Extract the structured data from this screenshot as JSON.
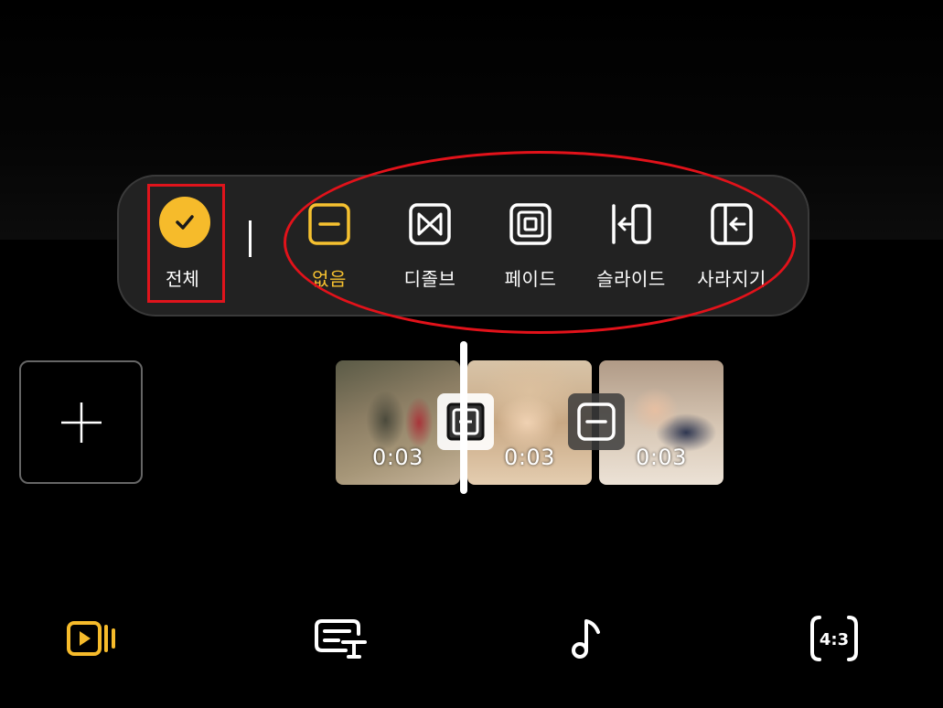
{
  "transition_panel": {
    "apply_all": {
      "label": "전체",
      "icon": "check-icon",
      "selected": true
    },
    "options": [
      {
        "key": "none",
        "label": "없음",
        "icon": "minus-square-icon",
        "active": true
      },
      {
        "key": "dissolve",
        "label": "디졸브",
        "icon": "dissolve-icon",
        "active": false
      },
      {
        "key": "fade",
        "label": "페이드",
        "icon": "fade-icon",
        "active": false
      },
      {
        "key": "slide",
        "label": "슬라이드",
        "icon": "slide-icon",
        "active": false
      },
      {
        "key": "disappear",
        "label": "사라지기",
        "icon": "disappear-icon",
        "active": false
      }
    ]
  },
  "timeline": {
    "add_button_icon": "plus-icon",
    "clips": [
      {
        "duration": "0:03"
      },
      {
        "duration": "0:03"
      },
      {
        "duration": "0:03"
      }
    ],
    "transitions": [
      {
        "icon": "add-transition-icon",
        "state": "selected"
      },
      {
        "icon": "minus-square-icon",
        "state": "none"
      }
    ]
  },
  "bottom_toolbar": {
    "tools": [
      {
        "key": "video",
        "icon": "video-clips-icon",
        "active": true
      },
      {
        "key": "text",
        "icon": "text-caption-icon",
        "active": false
      },
      {
        "key": "music",
        "icon": "music-note-icon",
        "active": false
      },
      {
        "key": "ratio",
        "icon": "aspect-ratio-icon",
        "label": "4:3",
        "active": false
      }
    ]
  },
  "colors": {
    "accent": "#f6bb2b",
    "annotation_red": "#e2121a",
    "panel_bg": "#222222"
  }
}
